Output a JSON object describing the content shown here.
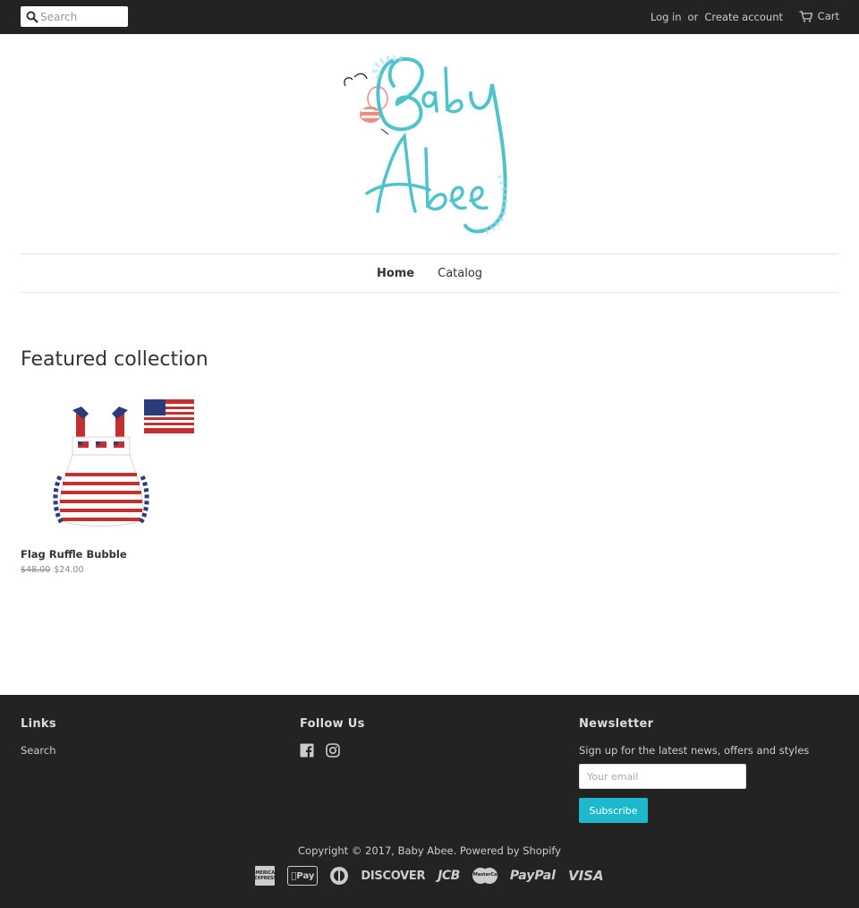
{
  "header": {
    "search_placeholder": "Search",
    "login_label": "Log in",
    "or_label": "or",
    "create_account_label": "Create account",
    "cart_label": "Cart"
  },
  "logo": {
    "text_line1": "Baby",
    "text_line2": "Abee"
  },
  "nav": {
    "items": [
      {
        "label": "Home"
      },
      {
        "label": "Catalog"
      }
    ]
  },
  "featured": {
    "title": "Featured collection",
    "products": [
      {
        "name": "Flag Ruffle Bubble",
        "old_price": "$48.00",
        "price": "$24.00"
      }
    ]
  },
  "footer": {
    "links_heading": "Links",
    "links": [
      {
        "label": "Search"
      }
    ],
    "follow_heading": "Follow Us",
    "social_icons": [
      "facebook-icon",
      "instagram-icon"
    ],
    "newsletter_heading": "Newsletter",
    "newsletter_text": "Sign up for the latest news, offers and styles",
    "email_placeholder": "Your email",
    "subscribe_label": "Subscribe",
    "copyright": "Copyright © 2017, Baby Abee. Powered by Shopify",
    "payments": {
      "amex": "AMERICAN EXPRESS",
      "applepay": "Pay",
      "discover": "DISCOVER",
      "jcb": "JCB",
      "mastercard": "MasterCard",
      "paypal": "PayPal",
      "visa": "VISA"
    }
  },
  "colors": {
    "topbar_bg": "#232323",
    "footer_bg": "#232323",
    "accent_teal": "#1eb8cc",
    "logo_teal": "#4fc3cc"
  }
}
